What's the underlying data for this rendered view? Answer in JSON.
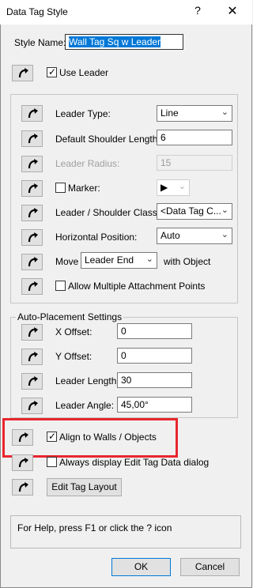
{
  "window": {
    "title": "Data Tag Style",
    "help_glyph": "?",
    "close_glyph": "✕"
  },
  "style_name": {
    "label": "Style Name:",
    "value": "Wall Tag Sq w Leader"
  },
  "use_leader": {
    "label": "Use Leader",
    "checked": true
  },
  "leader": {
    "type_label": "Leader Type:",
    "type_value": "Line",
    "shoulder_label": "Default Shoulder Length:",
    "shoulder_value": "6",
    "radius_label": "Leader Radius:",
    "radius_value": "15",
    "marker_label": "Marker:",
    "marker_value": "▶",
    "class_label": "Leader / Shoulder Class:",
    "class_value": "<Data Tag C...",
    "hpos_label": "Horizontal Position:",
    "hpos_value": "Auto",
    "move_label": "Move",
    "move_value": "Leader End",
    "with_object_label": "with Object",
    "multi_attach_label": "Allow Multiple Attachment Points"
  },
  "auto_placement": {
    "title": "Auto-Placement Settings",
    "x_label": "X Offset:",
    "x_value": "0",
    "y_label": "Y Offset:",
    "y_value": "0",
    "length_label": "Leader Length:",
    "length_value": "30",
    "angle_label": "Leader Angle:",
    "angle_value": "45,00°"
  },
  "align_walls": {
    "label": "Align to Walls / Objects",
    "checked": true
  },
  "always_display": {
    "label": "Always display Edit Tag Data dialog",
    "checked": false
  },
  "edit_layout_label": "Edit Tag Layout",
  "help_text": "For Help, press F1 or click the ? icon",
  "ok_label": "OK",
  "cancel_label": "Cancel",
  "colors": {
    "highlight": "#e8262e",
    "selection": "#0078d7"
  }
}
